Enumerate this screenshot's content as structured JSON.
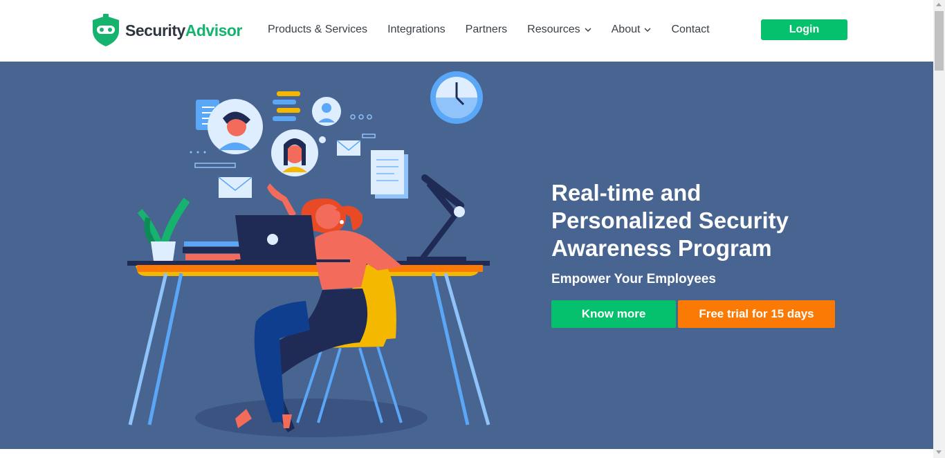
{
  "brand": {
    "name_part1": "Security",
    "name_part2": "Advisor",
    "primary_color": "#15b36e",
    "icon": "shield-robot-icon"
  },
  "nav": {
    "items": [
      {
        "label": "Products & Services",
        "has_dropdown": false
      },
      {
        "label": "Integrations",
        "has_dropdown": false
      },
      {
        "label": "Partners",
        "has_dropdown": false
      },
      {
        "label": "Resources",
        "has_dropdown": true
      },
      {
        "label": "About",
        "has_dropdown": true
      },
      {
        "label": "Contact",
        "has_dropdown": false
      }
    ],
    "login_label": "Login"
  },
  "hero": {
    "title": "Real-time and\nPersonalized Security\nAwareness Program",
    "subtitle": "Empower Your Employees",
    "primary_cta": "Know more",
    "secondary_cta": "Free trial for 15 days",
    "background_color": "#486592",
    "primary_cta_color": "#05c06c",
    "secondary_cta_color": "#fb7a06"
  }
}
